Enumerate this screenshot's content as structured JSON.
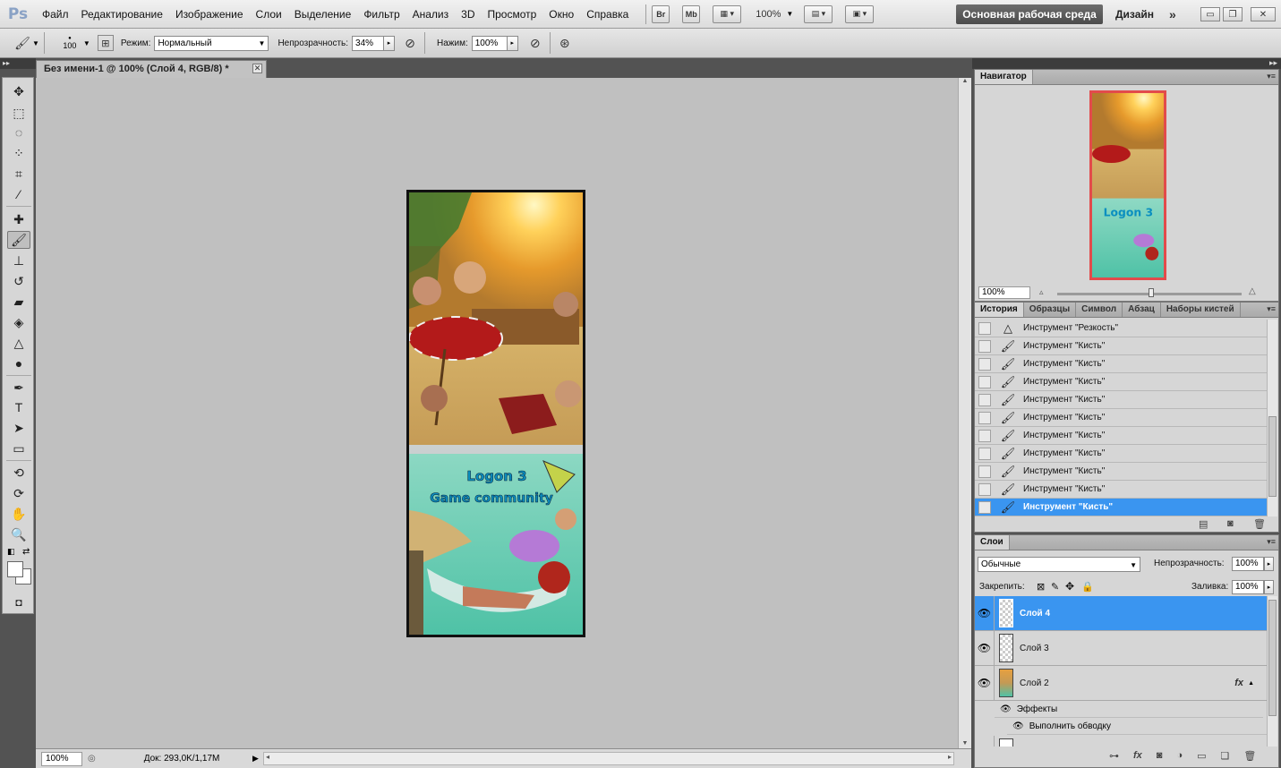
{
  "app": {
    "logo": "Ps",
    "menu": [
      "Файл",
      "Редактирование",
      "Изображение",
      "Слои",
      "Выделение",
      "Фильтр",
      "Анализ",
      "3D",
      "Просмотр",
      "Окно",
      "Справка"
    ],
    "bridge_label": "Br",
    "minibridge_label": "Mb",
    "zoom_level": "100%",
    "workspace": "Основная рабочая среда",
    "design_label": "Дизайн",
    "more_label": "»"
  },
  "options": {
    "brush_size": "100",
    "mode_label": "Режим:",
    "mode_value": "Нормальный",
    "opacity_label": "Непрозрачность:",
    "opacity_value": "34%",
    "flow_label": "Нажим:",
    "flow_value": "100%"
  },
  "document": {
    "tab_title": "Без имени-1 @ 100% (Слой 4, RGB/8) *",
    "zoom": "100%",
    "doc_info": "Док: 293,0K/1,17M",
    "artwork_title_line1": "Logon 3",
    "artwork_title_line2": "Game community"
  },
  "tools": [
    "move-tool",
    "marquee-tool",
    "lasso-tool",
    "quick-select-tool",
    "crop-tool",
    "eyedropper-tool",
    "healing-tool",
    "brush-tool",
    "stamp-tool",
    "history-brush-tool",
    "eraser-tool",
    "bucket-tool",
    "blur-tool",
    "dodge-tool",
    "pen-tool",
    "type-tool",
    "path-select-tool",
    "shape-tool",
    "3d-rotate-tool",
    "3d-orbit-tool",
    "hand-tool",
    "zoom-tool"
  ],
  "navigator": {
    "tab": "Навигатор",
    "zoom": "100%"
  },
  "history": {
    "tabs": [
      "История",
      "Образцы",
      "Символ",
      "Абзац",
      "Наборы кистей"
    ],
    "items": [
      {
        "label": "Инструмент \"Резкость\"",
        "icon": "sharpen-icon"
      },
      {
        "label": "Инструмент \"Кисть\"",
        "icon": "brush-icon"
      },
      {
        "label": "Инструмент \"Кисть\"",
        "icon": "brush-icon"
      },
      {
        "label": "Инструмент \"Кисть\"",
        "icon": "brush-icon"
      },
      {
        "label": "Инструмент \"Кисть\"",
        "icon": "brush-icon"
      },
      {
        "label": "Инструмент \"Кисть\"",
        "icon": "brush-icon"
      },
      {
        "label": "Инструмент \"Кисть\"",
        "icon": "brush-icon"
      },
      {
        "label": "Инструмент \"Кисть\"",
        "icon": "brush-icon"
      },
      {
        "label": "Инструмент \"Кисть\"",
        "icon": "brush-icon"
      },
      {
        "label": "Инструмент \"Кисть\"",
        "icon": "brush-icon"
      },
      {
        "label": "Инструмент \"Кисть\"",
        "icon": "brush-icon"
      }
    ],
    "selected_index": 10
  },
  "layers": {
    "tab": "Слои",
    "blend_mode": "Обычные",
    "opacity_label": "Непрозрачность:",
    "opacity_value": "100%",
    "lock_label": "Закрепить:",
    "fill_label": "Заливка:",
    "fill_value": "100%",
    "items": [
      {
        "name": "Слой 4",
        "selected": true
      },
      {
        "name": "Слой 3",
        "selected": false
      },
      {
        "name": "Слой 2",
        "selected": false,
        "fx": "fx"
      }
    ],
    "effects_label": "Эффекты",
    "stroke_effect_label": "Выполнить обводку"
  },
  "colors": {
    "accent": "#3a95f0",
    "panel": "#d6d6d6",
    "canvas_bg": "#c0c0c0",
    "dark_chrome": "#535353"
  }
}
